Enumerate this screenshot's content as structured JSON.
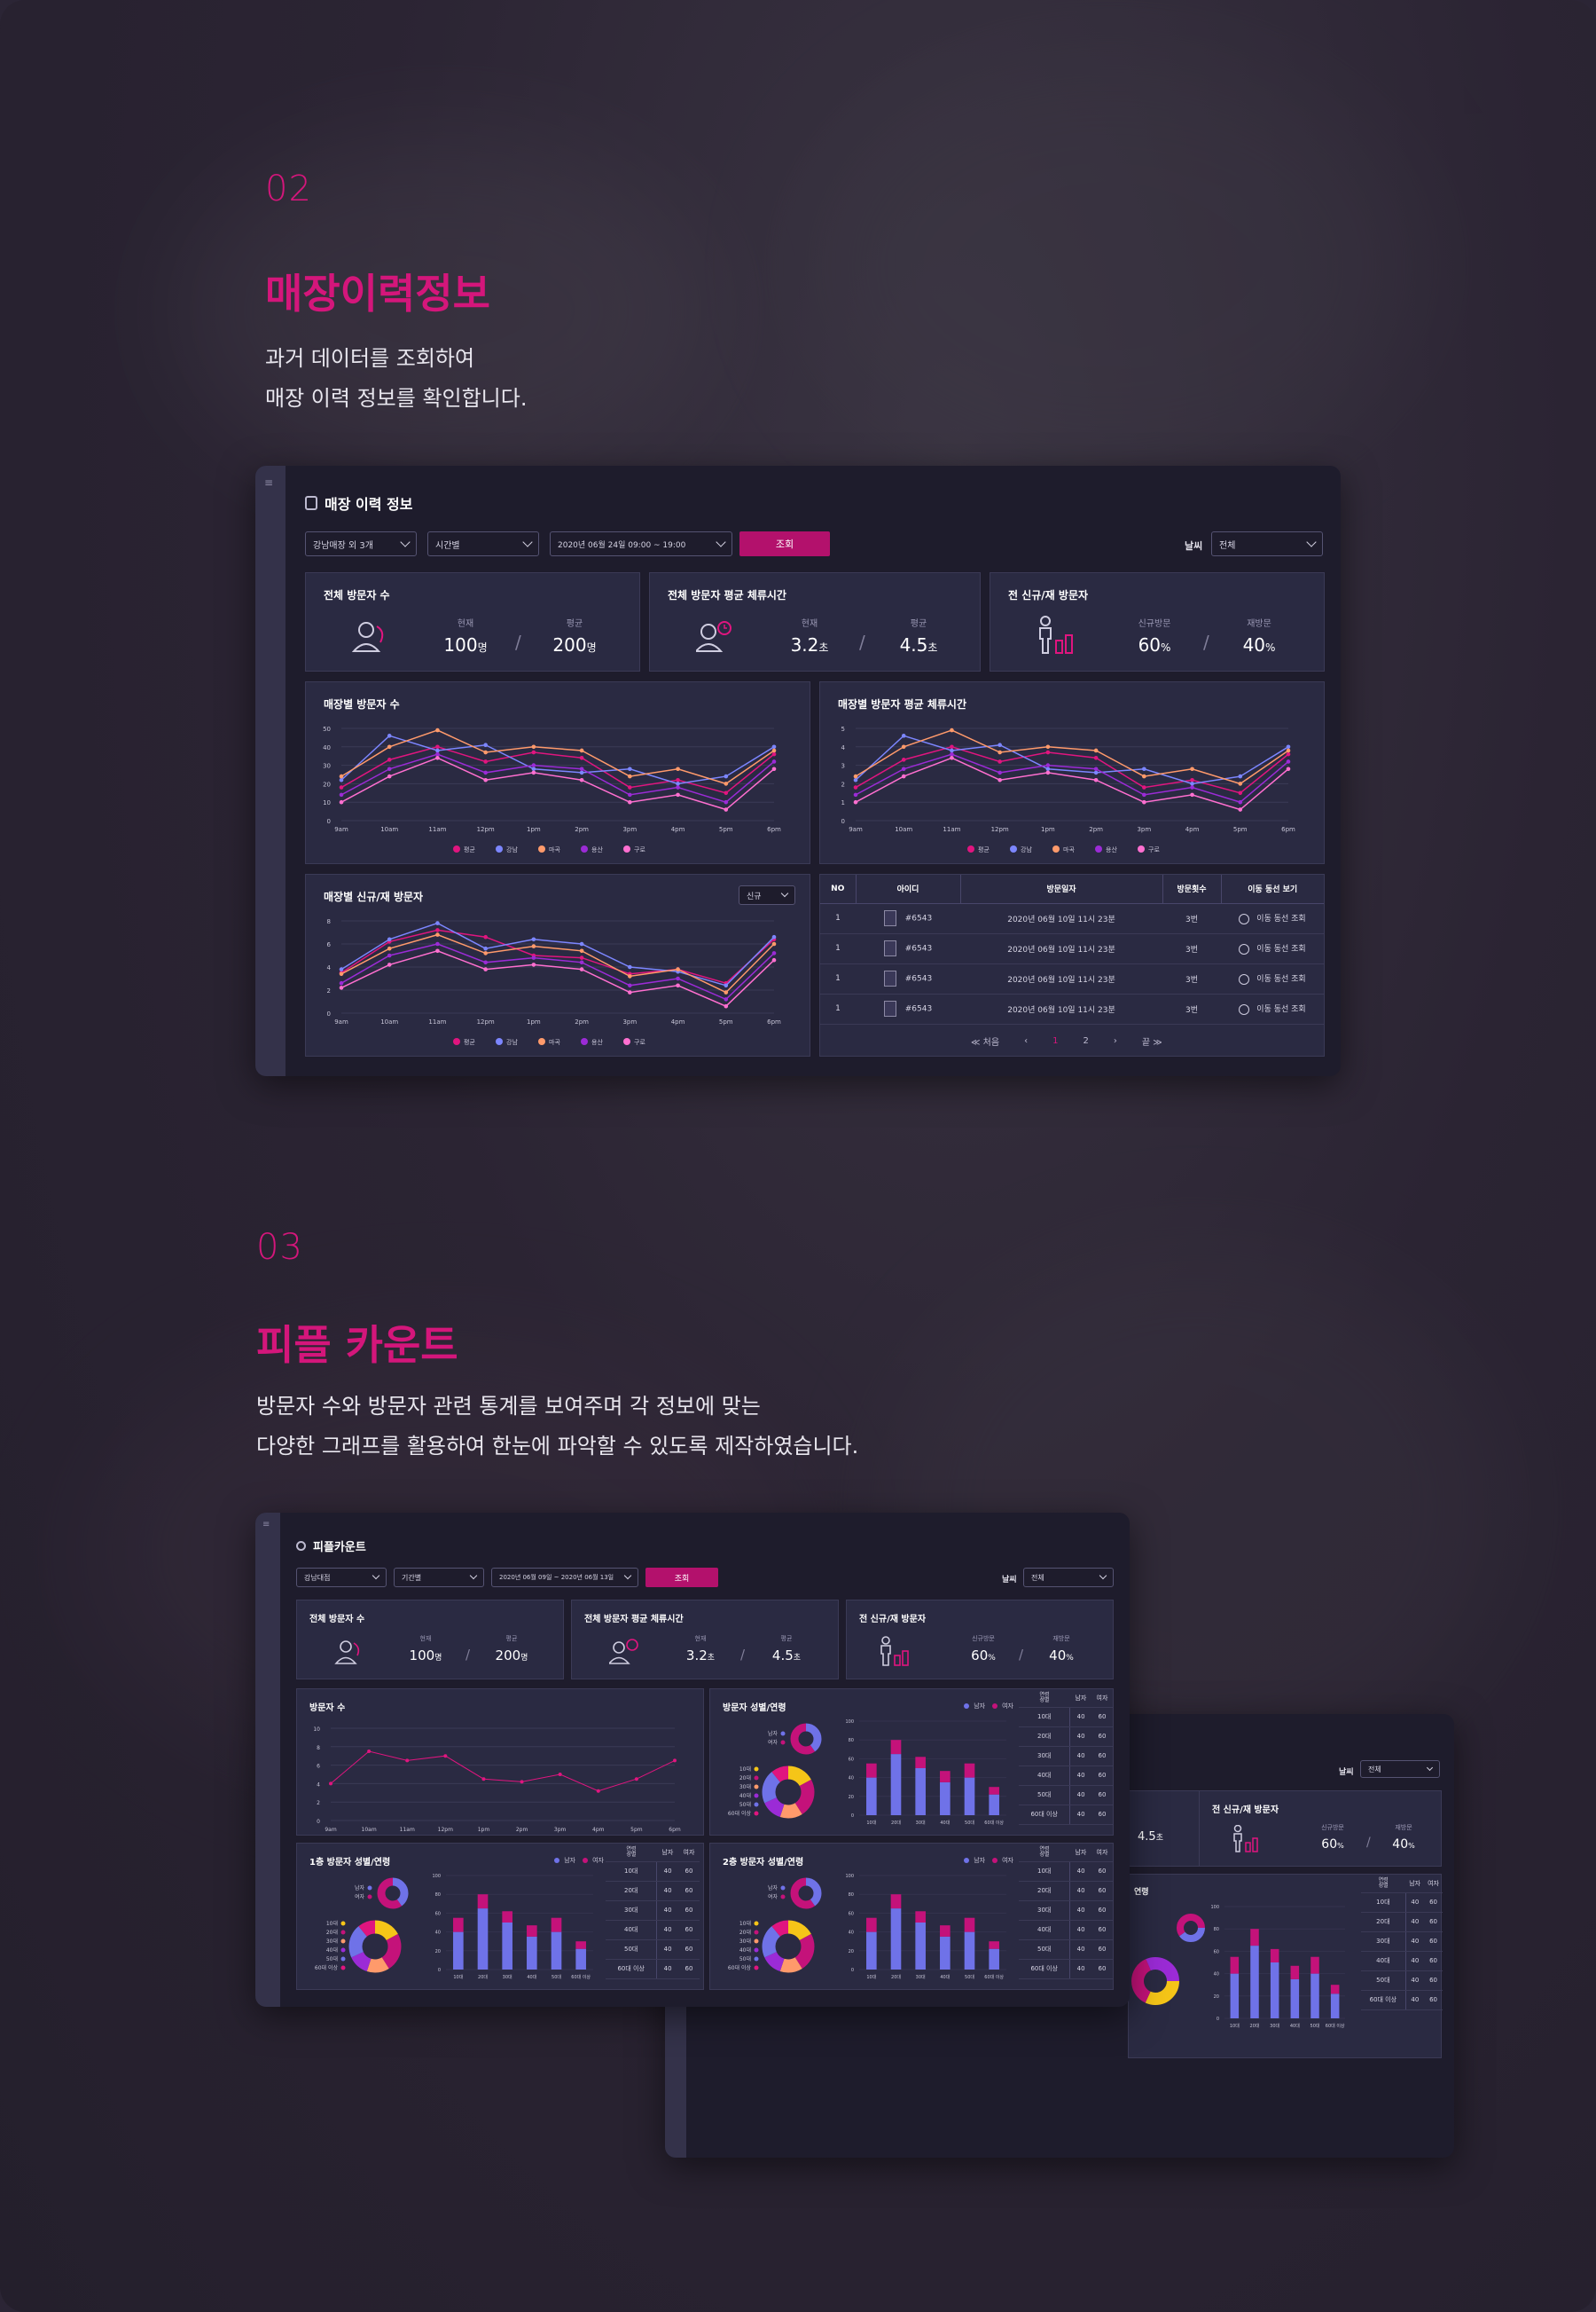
{
  "section1": {
    "number": "02",
    "title": "매장이력정보",
    "desc1": "과거 데이터를 조회하여",
    "desc2": "매장 이력 정보를 확인합니다."
  },
  "screen1": {
    "title": "매장 이력 정보",
    "filters": {
      "store": "강남매장 외 3개",
      "period": "시간별",
      "date": "2020년 06월 24일 09:00 ~ 19:00",
      "search": "조회",
      "weather_label": "날씨",
      "weather": "전체"
    },
    "cards": [
      {
        "title": "전체 방문자 수",
        "k1": "현재",
        "v1": "100",
        "u1": "명",
        "k2": "평균",
        "v2": "200",
        "u2": "명"
      },
      {
        "title": "전체 방문자 평균 체류시간",
        "k1": "현재",
        "v1": "3.2",
        "u1": "초",
        "k2": "평균",
        "v2": "4.5",
        "u2": "초"
      },
      {
        "title": "전 신규/재 방문자",
        "k1": "신규방문",
        "v1": "60",
        "u1": "%",
        "k2": "재방문",
        "v2": "40",
        "u2": "%"
      }
    ],
    "chart_visitors": {
      "title": "매장별 방문자 수"
    },
    "chart_dwell": {
      "title": "매장별 방문자 평균 체류시간"
    },
    "chart_newret": {
      "title": "매장별 신규/재 방문자",
      "select": "신규"
    },
    "legend": [
      "평균",
      "강남",
      "마곡",
      "용산",
      "구로"
    ],
    "table": {
      "headers": [
        "NO",
        "아이디",
        "방문일자",
        "방문횟수",
        "이동 동선 보기"
      ],
      "rows": [
        {
          "no": "1",
          "id": "#6543",
          "date": "2020년 06월 10일 11시 23분",
          "count": "3번",
          "action": "이동 동선 조회"
        },
        {
          "no": "1",
          "id": "#6543",
          "date": "2020년 06월 10일 11시 23분",
          "count": "3번",
          "action": "이동 동선 조회"
        },
        {
          "no": "1",
          "id": "#6543",
          "date": "2020년 06월 10일 11시 23분",
          "count": "3번",
          "action": "이동 동선 조회"
        },
        {
          "no": "1",
          "id": "#6543",
          "date": "2020년 06월 10일 11시 23분",
          "count": "3번",
          "action": "이동 동선 조회"
        }
      ],
      "pagination": {
        "first": "≪ 처음",
        "prev": "‹",
        "p1": "1",
        "p2": "2",
        "next": "›",
        "last": "끝 ≫"
      }
    }
  },
  "section2": {
    "number": "03",
    "title": "피플 카운트",
    "desc1": "방문자 수와 방문자 관련 통계를 보여주며 각 정보에 맞는",
    "desc2": "다양한 그래프를 활용하여 한눈에 파악할 수 있도록 제작하였습니다."
  },
  "screen2": {
    "title": "피플카운트",
    "filters": {
      "store": "강남대점",
      "period": "기간별",
      "date": "2020년 06월 09일 ~ 2020년 06월 13일",
      "search": "조회",
      "weather_label": "날씨",
      "weather": "전체"
    },
    "cards": [
      {
        "title": "전체 방문자 수",
        "k1": "현재",
        "v1": "100",
        "u1": "명",
        "k2": "평균",
        "v2": "200",
        "u2": "명"
      },
      {
        "title": "전체 방문자 평균 체류시간",
        "k1": "현재",
        "v1": "3.2",
        "u1": "초",
        "k2": "평균",
        "v2": "4.5",
        "u2": "초"
      },
      {
        "title": "전 신규/재 방문자",
        "k1": "신규방문",
        "v1": "60",
        "u1": "%",
        "k2": "재방문",
        "v2": "40",
        "u2": "%"
      }
    ],
    "panels": {
      "visitors": "방문자 수",
      "gender_age": "방문자 성별/연령",
      "floor1": "1층 방문자 성별/연령",
      "floor2": "2층 방문자 성별/연령"
    },
    "gender_legend": [
      "남자",
      "여자"
    ],
    "age_table": {
      "h1": "연령",
      "h1b": "성별",
      "h2": "남자",
      "h3": "여자",
      "rows": [
        [
          "10대",
          "40",
          "60"
        ],
        [
          "20대",
          "40",
          "60"
        ],
        [
          "30대",
          "40",
          "60"
        ],
        [
          "40대",
          "40",
          "60"
        ],
        [
          "50대",
          "40",
          "60"
        ],
        [
          "60대 이상",
          "40",
          "60"
        ]
      ]
    }
  },
  "screen3": {
    "weather_label": "날씨",
    "weather": "전체",
    "card_title": "전 신규/재 방문자",
    "k1": "신규방문",
    "v1": "60",
    "u1": "%",
    "k2": "재방문",
    "v2": "40",
    "u2": "%",
    "v_left": "4.5",
    "u_left": "초",
    "panel": "연령"
  },
  "chart_data": [
    {
      "type": "line",
      "title": "매장별 방문자 수",
      "categories": [
        "9am",
        "10am",
        "11am",
        "12pm",
        "1pm",
        "2pm",
        "3pm",
        "4pm",
        "5pm",
        "6pm"
      ],
      "ylim": [
        0,
        50
      ],
      "yticks": [
        "0",
        "10",
        "20",
        "30",
        "40",
        "50"
      ],
      "series": [
        {
          "name": "평균",
          "color": "#e0157f",
          "values": [
            18,
            33,
            40,
            32,
            37,
            34,
            18,
            22,
            15,
            36
          ]
        },
        {
          "name": "강남",
          "color": "#7c86ff",
          "values": [
            22,
            46,
            38,
            41,
            28,
            26,
            28,
            20,
            24,
            40
          ]
        },
        {
          "name": "마곡",
          "color": "#ff9a6b",
          "values": [
            24,
            40,
            49,
            37,
            40,
            38,
            24,
            28,
            20,
            38
          ]
        },
        {
          "name": "용산",
          "color": "#9b2bd6",
          "values": [
            14,
            28,
            36,
            26,
            30,
            28,
            14,
            18,
            10,
            32
          ]
        },
        {
          "name": "구로",
          "color": "#ff6fd0",
          "values": [
            10,
            24,
            34,
            22,
            26,
            22,
            10,
            14,
            6,
            28
          ]
        }
      ]
    },
    {
      "type": "line",
      "title": "매장별 방문자 평균 체류시간",
      "categories": [
        "9am",
        "10am",
        "11am",
        "12pm",
        "1pm",
        "2pm",
        "3pm",
        "4pm",
        "5pm",
        "6pm"
      ],
      "ylim": [
        0,
        5
      ],
      "yticks": [
        "0",
        "1",
        "2",
        "3",
        "4",
        "5"
      ],
      "series": [
        {
          "name": "평균",
          "color": "#e0157f",
          "values": [
            1.8,
            3.3,
            4.0,
            3.2,
            3.7,
            3.4,
            1.8,
            2.2,
            1.5,
            3.6
          ]
        },
        {
          "name": "강남",
          "color": "#7c86ff",
          "values": [
            2.2,
            4.6,
            3.8,
            4.1,
            2.8,
            2.6,
            2.8,
            2.0,
            2.4,
            4.0
          ]
        },
        {
          "name": "마곡",
          "color": "#ff9a6b",
          "values": [
            2.4,
            4.0,
            4.9,
            3.7,
            4.0,
            3.8,
            2.4,
            2.8,
            2.0,
            3.8
          ]
        },
        {
          "name": "용산",
          "color": "#9b2bd6",
          "values": [
            1.4,
            2.8,
            3.6,
            2.6,
            3.0,
            2.8,
            1.4,
            1.8,
            1.0,
            3.2
          ]
        },
        {
          "name": "구로",
          "color": "#ff6fd0",
          "values": [
            1.0,
            2.4,
            3.4,
            2.2,
            2.6,
            2.2,
            1.0,
            1.4,
            0.6,
            2.8
          ]
        }
      ]
    },
    {
      "type": "line",
      "title": "매장별 신규/재 방문자",
      "categories": [
        "9am",
        "10am",
        "11am",
        "12pm",
        "1pm",
        "2pm",
        "3pm",
        "4pm",
        "5pm",
        "6pm"
      ],
      "ylim": [
        0,
        8
      ],
      "yticks": [
        "0",
        "2",
        "4",
        "6",
        "8"
      ],
      "series": [
        {
          "name": "평균",
          "color": "#e0157f",
          "values": [
            3.5,
            6.2,
            7.2,
            6.6,
            5.0,
            4.8,
            3.4,
            3.8,
            2.6,
            6.4
          ]
        },
        {
          "name": "강남",
          "color": "#7c86ff",
          "values": [
            3.8,
            6.4,
            7.8,
            5.6,
            6.4,
            6.0,
            4.0,
            3.6,
            2.4,
            6.6
          ]
        },
        {
          "name": "마곡",
          "color": "#ff9a6b",
          "values": [
            3.4,
            5.6,
            6.8,
            5.2,
            5.8,
            5.4,
            3.2,
            3.8,
            1.8,
            6.0
          ]
        },
        {
          "name": "용산",
          "color": "#9b2bd6",
          "values": [
            2.6,
            5.0,
            6.0,
            4.4,
            4.8,
            4.4,
            2.4,
            3.0,
            1.2,
            5.2
          ]
        },
        {
          "name": "구로",
          "color": "#ff6fd0",
          "values": [
            2.2,
            4.2,
            5.4,
            3.8,
            4.2,
            3.8,
            1.8,
            2.4,
            0.6,
            4.6
          ]
        }
      ]
    },
    {
      "type": "line",
      "title": "방문자 수",
      "categories": [
        "9am",
        "10am",
        "11am",
        "12pm",
        "1pm",
        "2pm",
        "3pm",
        "4pm",
        "5pm",
        "6pm"
      ],
      "ylim": [
        0,
        10
      ],
      "yticks": [
        "0",
        "2",
        "4",
        "6",
        "8",
        "10"
      ],
      "series": [
        {
          "name": "방문자",
          "color": "#e0157f",
          "values": [
            4.0,
            7.5,
            6.5,
            7.0,
            4.5,
            4.2,
            5.0,
            3.2,
            4.5,
            6.5
          ]
        }
      ]
    },
    {
      "type": "bar",
      "title": "방문자 성별/연령",
      "categories": [
        "10대",
        "20대",
        "30대",
        "40대",
        "50대",
        "60대 이상"
      ],
      "ylim": [
        0,
        100
      ],
      "series": [
        {
          "name": "남자",
          "color": "#6f72e8",
          "values": [
            40,
            65,
            50,
            35,
            40,
            22
          ]
        },
        {
          "name": "여자",
          "color": "#c4127a",
          "values": [
            15,
            15,
            12,
            12,
            15,
            8
          ]
        }
      ]
    },
    {
      "type": "bar",
      "title": "1층 방문자 성별/연령",
      "categories": [
        "10대",
        "20대",
        "30대",
        "40대",
        "50대",
        "60대 이상"
      ],
      "ylim": [
        0,
        100
      ],
      "series": [
        {
          "name": "남자",
          "color": "#6f72e8",
          "values": [
            40,
            65,
            50,
            35,
            40,
            22
          ]
        },
        {
          "name": "여자",
          "color": "#c4127a",
          "values": [
            15,
            15,
            12,
            12,
            15,
            8
          ]
        }
      ]
    },
    {
      "type": "bar",
      "title": "2층 방문자 성별/연령",
      "categories": [
        "10대",
        "20대",
        "30대",
        "40대",
        "50대",
        "60대 이상"
      ],
      "ylim": [
        0,
        100
      ],
      "series": [
        {
          "name": "남자",
          "color": "#6f72e8",
          "values": [
            40,
            65,
            50,
            35,
            40,
            22
          ]
        },
        {
          "name": "여자",
          "color": "#c4127a",
          "values": [
            15,
            15,
            12,
            12,
            15,
            8
          ]
        }
      ]
    },
    {
      "type": "pie",
      "title": "성별",
      "categories": [
        "남자",
        "여자"
      ],
      "values": [
        40,
        60
      ]
    },
    {
      "type": "pie",
      "title": "연령",
      "categories": [
        "10대",
        "20대",
        "30대",
        "40대",
        "50대",
        "60대 이상"
      ],
      "values": [
        17,
        24,
        14,
        13,
        21,
        11
      ]
    }
  ]
}
